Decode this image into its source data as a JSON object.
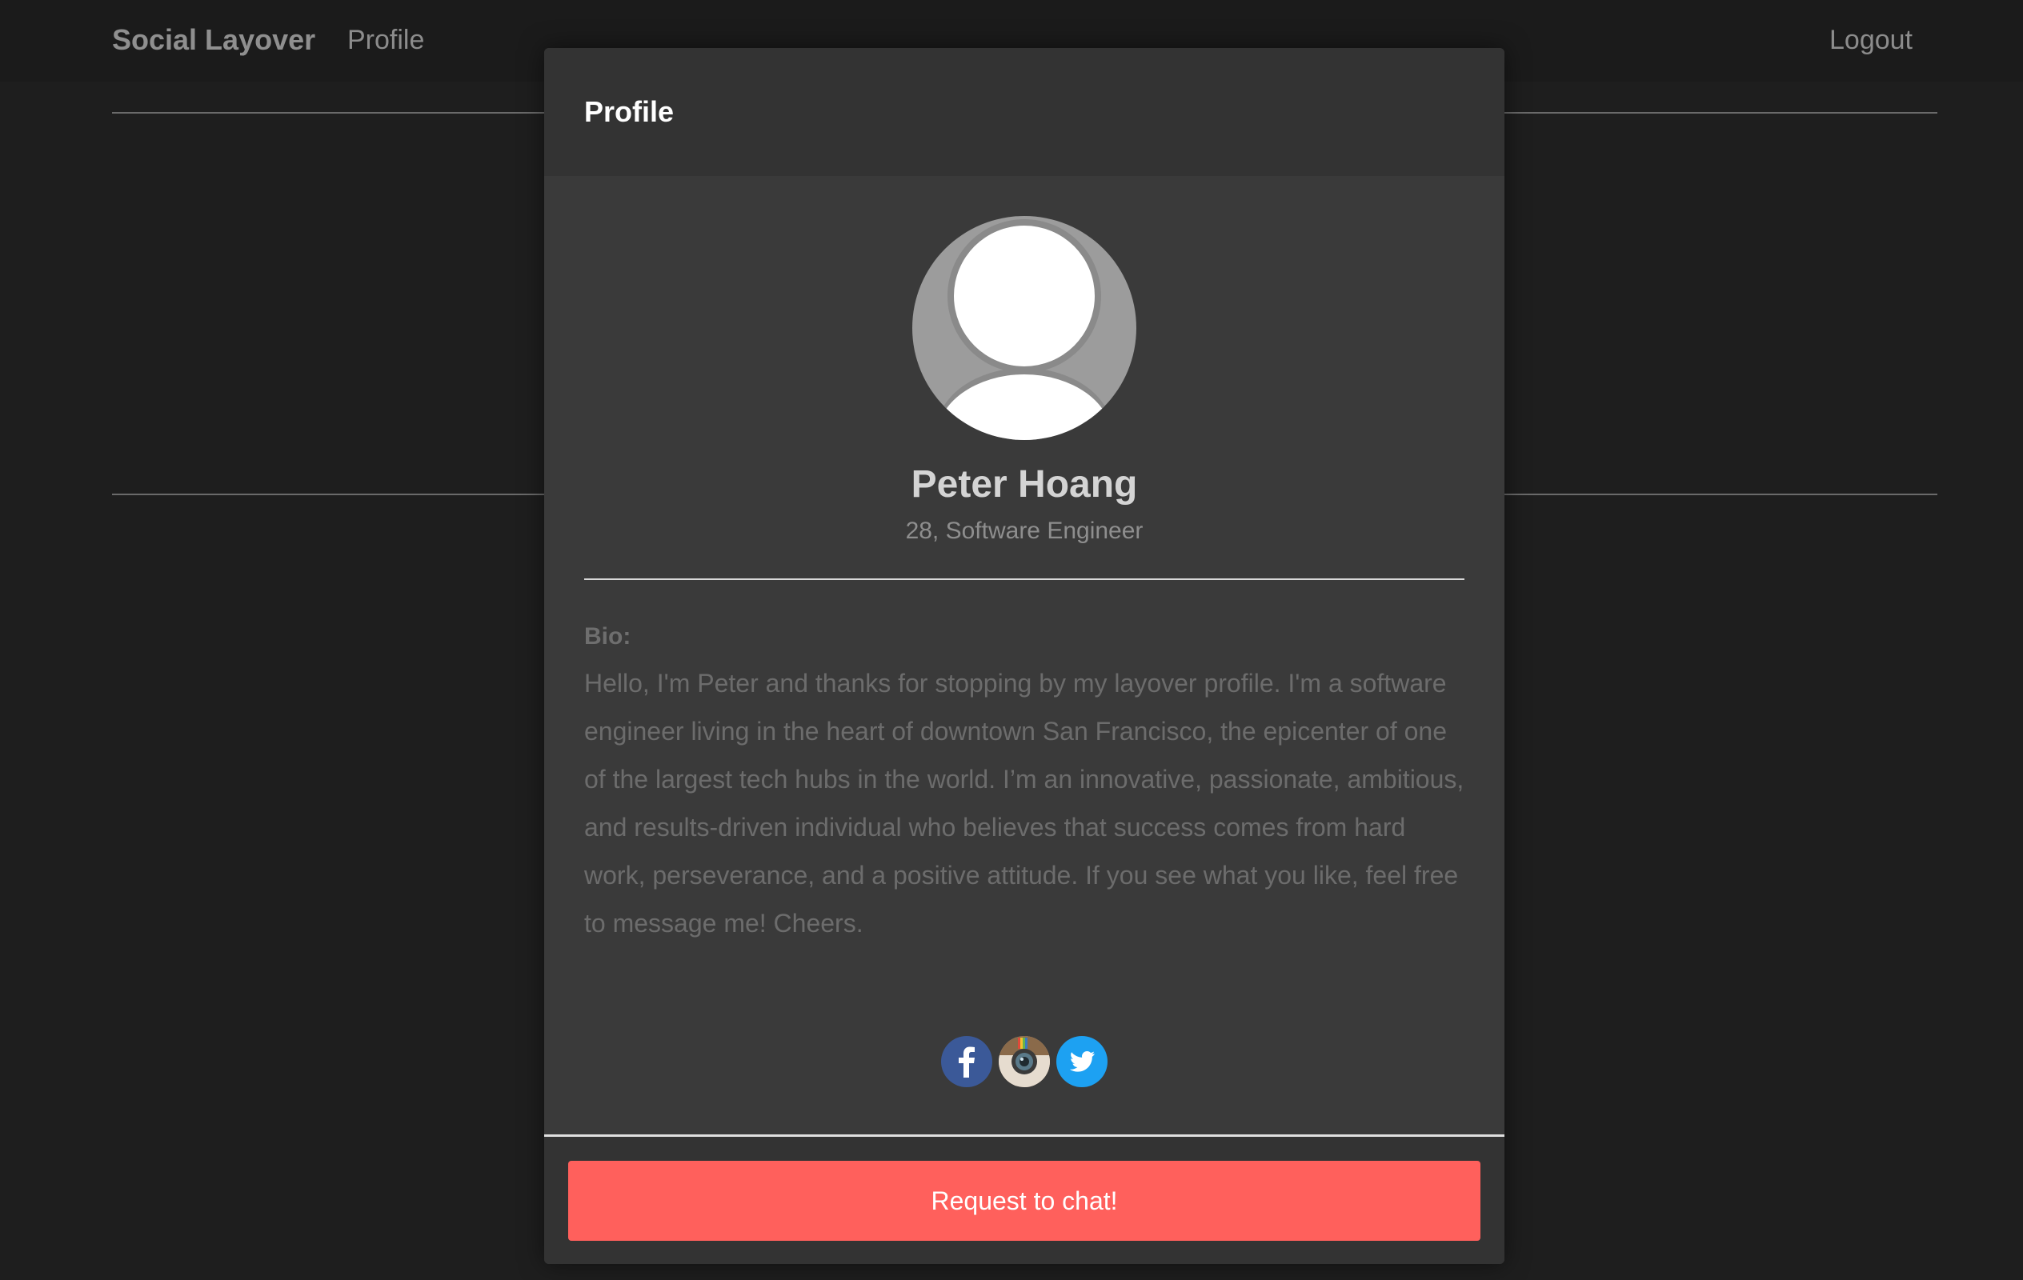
{
  "navbar": {
    "brand": "Social Layover",
    "profile_link": "Profile",
    "logout_link": "Logout"
  },
  "modal": {
    "title": "Profile",
    "user": {
      "name": "Peter Hoang",
      "subtitle": "28, Software Engineer"
    },
    "bio_label": "Bio:",
    "bio_text": "Hello, I'm Peter and thanks for stopping by my layover profile. I'm a software engineer living in the heart of downtown San Francisco, the epicenter of one of the largest tech hubs in the world. I’m an innovative, passionate, ambitious, and results-driven individual who believes that success comes from hard work, perseverance, and a positive attitude. If you see what you like, feel free to message me! Cheers.",
    "social_icons": [
      "facebook-icon",
      "instagram-icon",
      "twitter-icon"
    ],
    "chat_button": "Request to chat!"
  },
  "colors": {
    "accent": "#ff605c",
    "background": "#1e1e1e",
    "modal_bg": "#3a3a3a",
    "facebook": "#3b5998",
    "twitter": "#1da1f2"
  }
}
